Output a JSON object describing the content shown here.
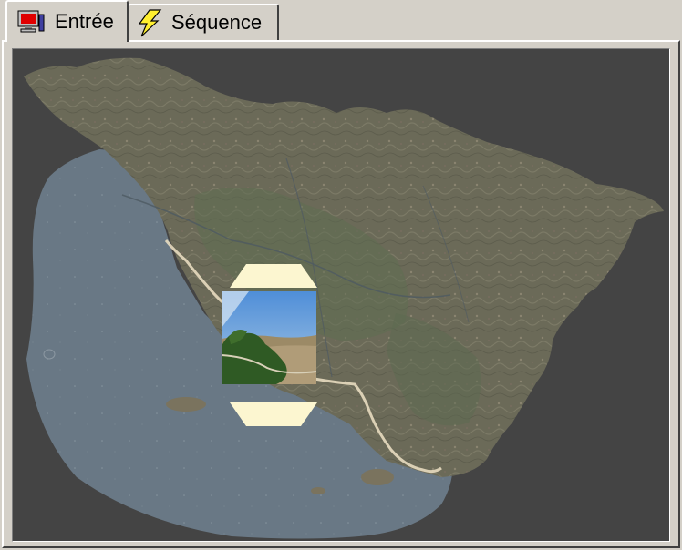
{
  "tabs": [
    {
      "label": "Entrée",
      "icon": "monitor-icon",
      "active": true
    },
    {
      "label": "Séquence",
      "icon": "lightning-icon",
      "active": false
    }
  ],
  "map": {
    "description_icon": "map-icon",
    "background_color": "#444444",
    "land_color": "#6b6b55",
    "sea_color": "#6a7a88",
    "route_color": "#e8dcc0"
  },
  "photo": {
    "icon": "photo-thumbnail-icon",
    "up_arrow_icon": "arrow-up-icon",
    "down_arrow_icon": "arrow-down-icon",
    "arrow_color": "#fcf6d0"
  }
}
